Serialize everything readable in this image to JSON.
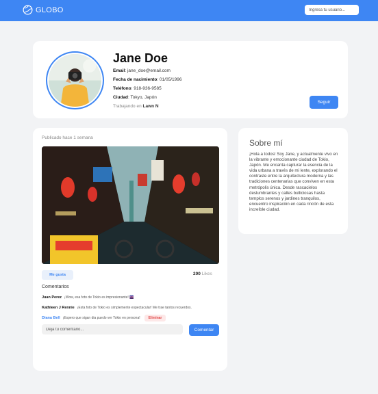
{
  "header": {
    "brand": "GLOBO",
    "logo_icon": "globe-icon",
    "search_placeholder": "Ingresa tu usuario..."
  },
  "profile": {
    "name": "Jane Doe",
    "email_label": "Email",
    "email": "jane_doe@email.com",
    "birth_label": "Fecha de nacimiento",
    "birth": "01/05/1996",
    "phone_label": "Teléfono",
    "phone": "918-936-9585",
    "city_label": "Ciudad",
    "city": "Tokyo, Japón",
    "work_prefix": "Trabajando en",
    "work_company": "Lawn N",
    "follow_label": "Seguir"
  },
  "post": {
    "published": "Publicado hace 1 semana",
    "like_label": "Me gusta",
    "likes_count": "200",
    "likes_suffix": "Likes",
    "comments_title": "Comentarios",
    "comments": [
      {
        "author": "Juan Perez",
        "text": "¡Wow, esa foto de Tokio es impresionante! 🌆"
      },
      {
        "author": "Kathleen J Rennie",
        "text": "¡Esta foto de Tokio es simplemente espectacular! Me trae tantos recuerdos."
      },
      {
        "author": "Diana Bell",
        "text": "¡Espero que sigan dia puedo ver Tokio en persona!",
        "delete_label": "Eliminar"
      }
    ],
    "comment_placeholder": "Deja tu comentario...",
    "comment_button": "Comentar"
  },
  "about": {
    "title": "Sobre mí",
    "text": "¡Hola a todos! Soy Jane, y actualmente vivo en la vibrante y emocionante ciudad de Tokio, Japón. Me encanta capturar la esencia de la vida urbana a través de mi lente, explorando el contraste entre la arquitectura moderna y las tradiciones centenarias que conviven en esta metrópolis única. Desde rascacielos deslumbrantes y calles bulliciosas hasta templos serenos y jardines tranquilos, encuentro inspiración en cada rincón de esta increíble ciudad."
  },
  "colors": {
    "accent": "#3e86f3",
    "background": "#f2f3f5",
    "danger": "#e04848"
  }
}
